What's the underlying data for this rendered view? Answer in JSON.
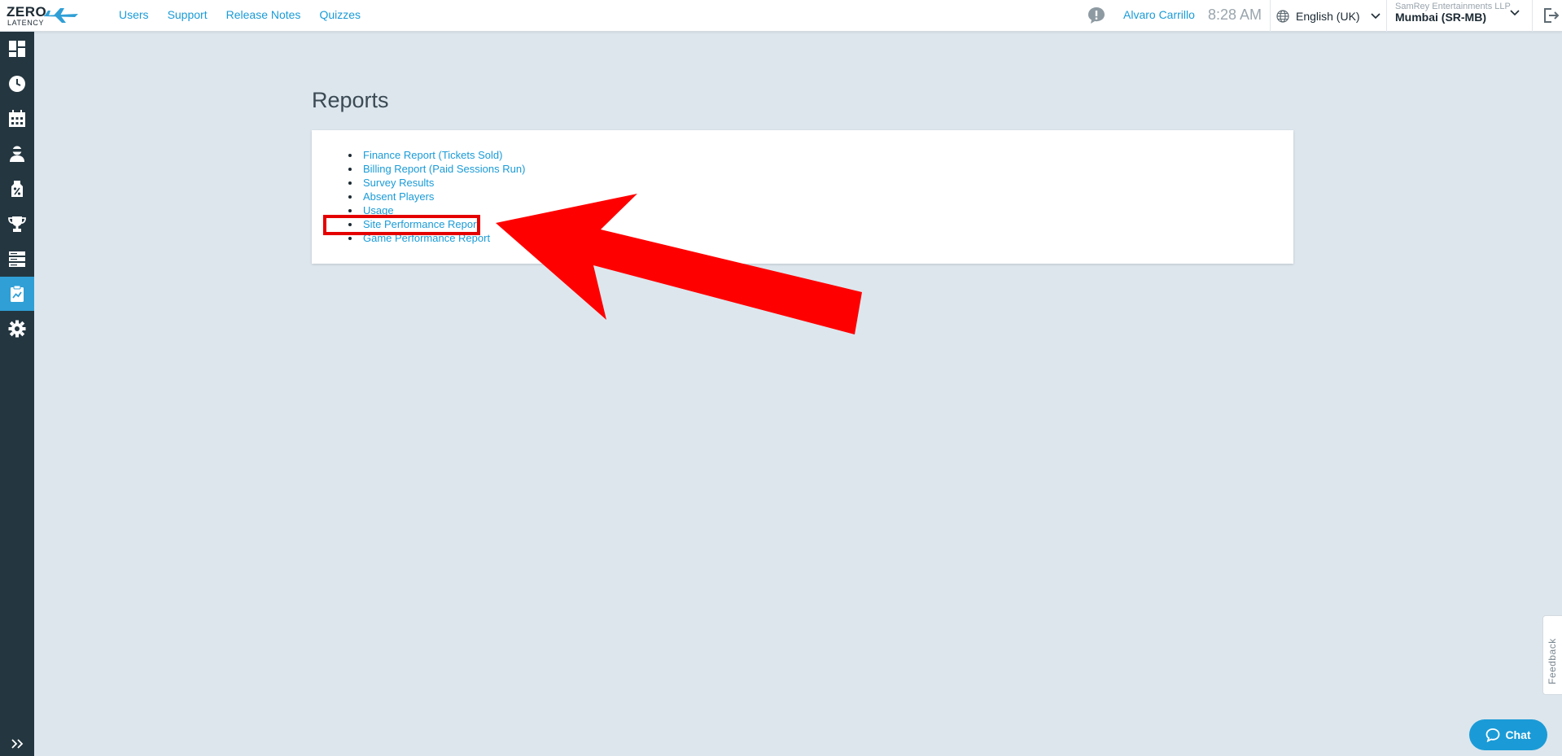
{
  "brand": {
    "logo_line1": "ZERO",
    "logo_line2": "LATENCY"
  },
  "topnav": [
    "Users",
    "Support",
    "Release Notes",
    "Quizzes"
  ],
  "header": {
    "username": "Alvaro Carrillo",
    "time": "8:28 AM",
    "language": "English (UK)",
    "company": "SamRey Entertainments LLP",
    "location": "Mumbai (SR-MB)"
  },
  "sidebar": {
    "items": [
      {
        "icon": "dashboard-icon"
      },
      {
        "icon": "clock-icon"
      },
      {
        "icon": "calendar-icon"
      },
      {
        "icon": "player-icon"
      },
      {
        "icon": "discount-tag-icon"
      },
      {
        "icon": "trophy-icon"
      },
      {
        "icon": "servers-icon"
      },
      {
        "icon": "reports-icon",
        "active": true
      },
      {
        "icon": "gear-icon"
      }
    ],
    "expand_icon": "double-chevron-right-icon"
  },
  "main": {
    "title": "Reports",
    "reports": [
      "Finance Report (Tickets Sold)",
      "Billing Report (Paid Sessions Run)",
      "Survey Results",
      "Absent Players",
      "Usage",
      "Site Performance Report",
      "Game Performance Report"
    ],
    "highlighted_report": "Site Performance Report"
  },
  "feedback_label": "Feedback",
  "chat_label": "Chat",
  "colors": {
    "accent": "#1a9bd7",
    "sidebar": "#243640",
    "annotation": "#ff0000",
    "background": "#dde6ed"
  }
}
